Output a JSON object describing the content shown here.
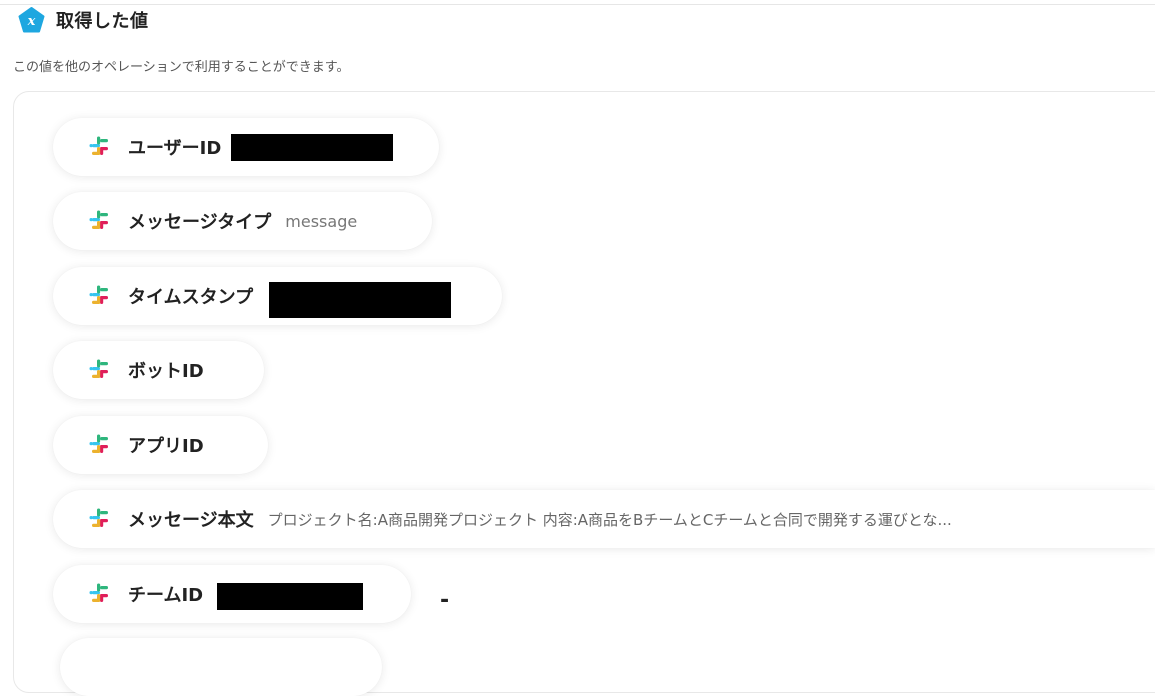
{
  "header": {
    "title": "取得した値",
    "badge_icon": "variable-x-icon",
    "badge_color": "#1ea7e0"
  },
  "subtitle": "この値を他のオペレーションで利用することができます。",
  "items": [
    {
      "label": "ユーザーID",
      "value": "",
      "redacted": true,
      "icon": "slack-icon"
    },
    {
      "label": "メッセージタイプ",
      "value": "message",
      "redacted": false,
      "icon": "slack-icon"
    },
    {
      "label": "タイムスタンプ",
      "value": "",
      "redacted": true,
      "icon": "slack-icon"
    },
    {
      "label": "ボットID",
      "value": "",
      "redacted": false,
      "icon": "slack-icon"
    },
    {
      "label": "アプリID",
      "value": "",
      "redacted": false,
      "icon": "slack-icon"
    },
    {
      "label": "メッセージ本文",
      "value": "プロジェクト名:A商品開発プロジェクト 内容:A商品をBチームとCチームと合同で開発する運びとな...",
      "redacted": false,
      "icon": "slack-icon"
    },
    {
      "label": "チームID",
      "value": "",
      "redacted": true,
      "icon": "slack-icon"
    }
  ],
  "trailing_dash": "-",
  "colors": {
    "slack_green": "#2eb67d",
    "slack_blue": "#36c5f0",
    "slack_red": "#e01e5a",
    "slack_yellow": "#ecb22e"
  }
}
